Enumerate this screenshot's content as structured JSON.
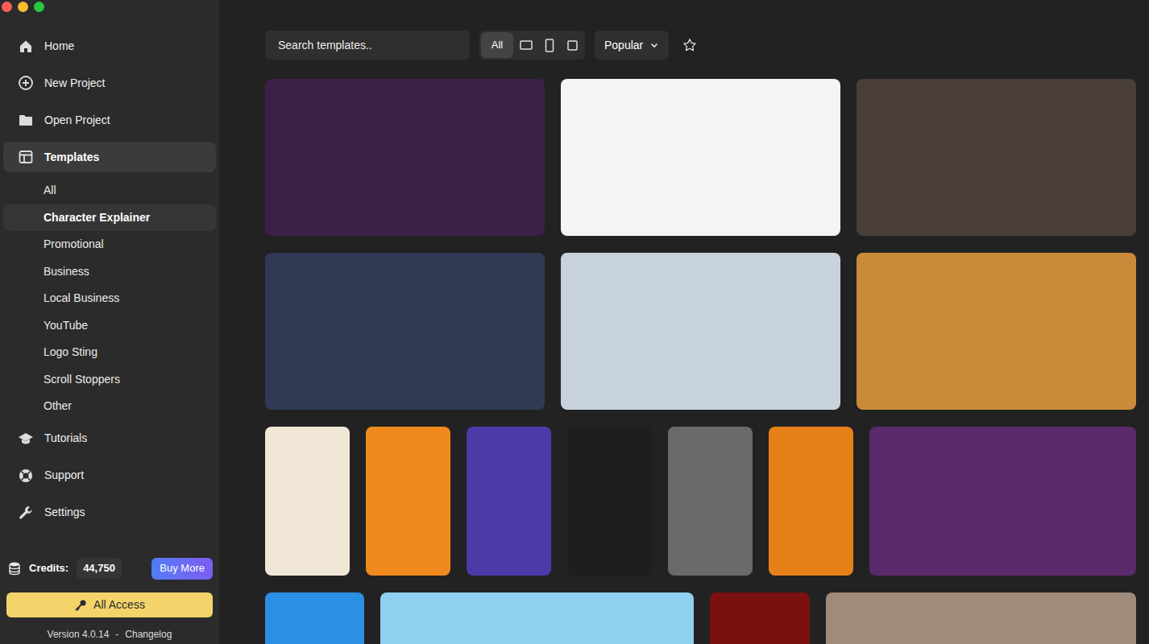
{
  "window": {
    "controls": [
      {
        "color": "#ff5f57"
      },
      {
        "color": "#febc2e"
      },
      {
        "color": "#28c840"
      }
    ]
  },
  "sidebar": {
    "items": [
      {
        "label": "Home",
        "selected": false
      },
      {
        "label": "New Project",
        "selected": false
      },
      {
        "label": "Open Project",
        "selected": false
      },
      {
        "label": "Templates",
        "selected": true
      }
    ],
    "categories": [
      {
        "label": "All",
        "selected": false
      },
      {
        "label": "Character Explainer",
        "selected": true
      },
      {
        "label": "Promotional",
        "selected": false
      },
      {
        "label": "Business",
        "selected": false
      },
      {
        "label": "Local Business",
        "selected": false
      },
      {
        "label": "YouTube",
        "selected": false
      },
      {
        "label": "Logo Sting",
        "selected": false
      },
      {
        "label": "Scroll Stoppers",
        "selected": false
      },
      {
        "label": "Other",
        "selected": false
      }
    ],
    "more_items": [
      {
        "label": "Tutorials",
        "selected": false
      },
      {
        "label": "Support",
        "selected": false
      },
      {
        "label": "Settings",
        "selected": false
      }
    ],
    "credits": {
      "label": "Credits:",
      "value": "44,750",
      "button": "Buy More"
    },
    "plan_button": "All Access",
    "footer": {
      "version": "Version 4.0.14",
      "separator": "-",
      "link": "Changelog"
    }
  },
  "toolbar": {
    "search": {
      "placeholder": "Search templates.."
    },
    "filters": [
      {
        "kind": "all",
        "label": "All",
        "selected": true
      },
      {
        "kind": "landscape",
        "selected": false
      },
      {
        "kind": "portrait",
        "selected": false
      },
      {
        "kind": "square",
        "selected": false
      }
    ],
    "sort": {
      "value": "Popular"
    },
    "favorites": {
      "selected": false
    }
  },
  "templates": {
    "rows": [
      [
        {
          "color": "#3b2147"
        },
        {
          "color": "#f4f4f4"
        },
        {
          "color": "#4a3f38"
        }
      ],
      [
        {
          "color": "#2f3a55"
        },
        {
          "color": "#c8d2dc"
        },
        {
          "color": "#c98a3a"
        }
      ],
      [
        {
          "color": "#efe6d6"
        },
        {
          "color": "#f08a1e"
        },
        {
          "color": "#4b3aa8"
        },
        {
          "color": "#1e1e1e"
        },
        {
          "color": "#6a6a6a"
        },
        {
          "color": "#e8801a"
        },
        {
          "color": "#5a2a6a"
        }
      ],
      [
        {
          "color": "#2b8fe6"
        },
        {
          "color": "#8fd0f0"
        },
        {
          "color": "#7a1010"
        },
        {
          "color": "#a08a7a"
        }
      ]
    ]
  }
}
